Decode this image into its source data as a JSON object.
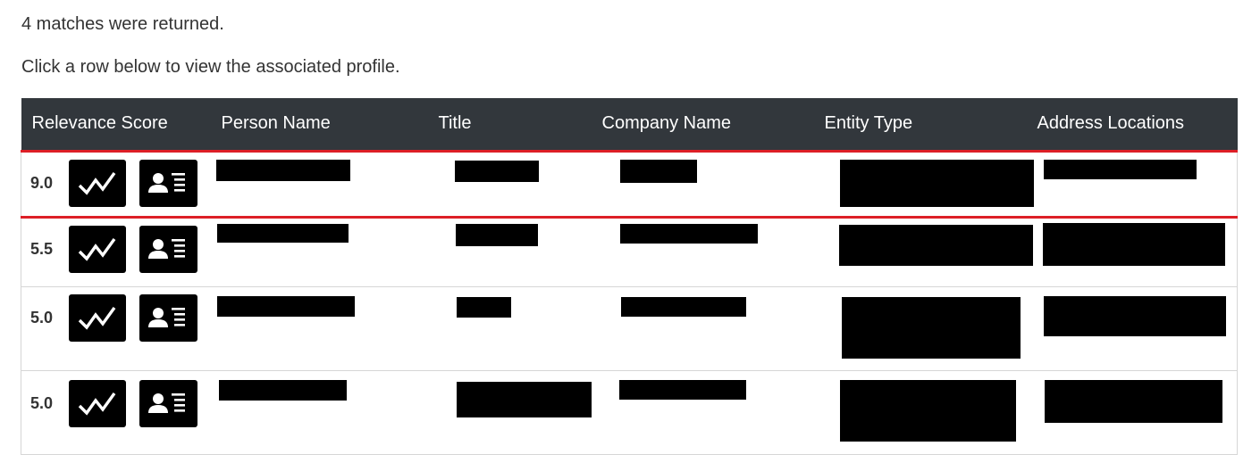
{
  "messages": {
    "count": "4 matches were returned.",
    "hint": "Click a row below to view the associated profile."
  },
  "table": {
    "headers": {
      "relevance": "Relevance Score",
      "person": "Person Name",
      "title": "Title",
      "company": "Company Name",
      "entity": "Entity Type",
      "address": "Address Locations"
    },
    "rows": [
      {
        "score": "9.0",
        "selected": true
      },
      {
        "score": "5.5",
        "selected": false
      },
      {
        "score": "5.0",
        "selected": false
      },
      {
        "score": "5.0",
        "selected": false
      }
    ]
  },
  "icons": {
    "chart_button": "line-chart-icon",
    "profile_button": "profile-card-icon"
  },
  "colors": {
    "header_bg": "#32373c",
    "selection": "#dd1f26",
    "redaction": "#000000"
  }
}
